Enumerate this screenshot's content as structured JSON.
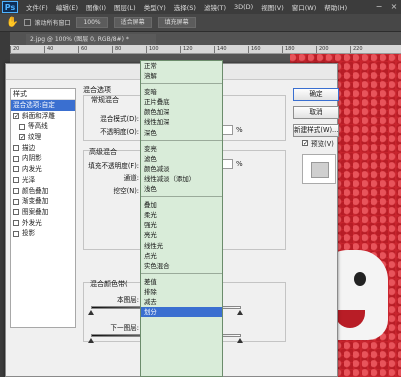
{
  "app": {
    "logo": "Ps",
    "menus": [
      "文件(F)",
      "编辑(E)",
      "图像(I)",
      "图层(L)",
      "类型(Y)",
      "选择(S)",
      "滤镜(T)",
      "3D(D)",
      "视图(V)",
      "窗口(W)",
      "帮助(H)"
    ]
  },
  "options_bar": {
    "scroll_all_label": "滚动所有窗口",
    "zoom_100": "100%",
    "fit_screen": "适合屏幕",
    "fill_screen": "填充屏幕"
  },
  "document": {
    "tab_title": "2.jpg @ 100% (图层 0, RGB/8#) *",
    "ruler_ticks": [
      "20",
      "40",
      "60",
      "80",
      "100",
      "120",
      "140",
      "160",
      "180",
      "200",
      "220"
    ]
  },
  "dialog": {
    "title": "图层样式",
    "styles_header": "样式",
    "styles": [
      {
        "label": "混合选项:自定",
        "checkbox": false,
        "checked": false,
        "indent": false,
        "selected": true
      },
      {
        "label": "斜面和浮雕",
        "checkbox": true,
        "checked": true,
        "indent": false,
        "selected": false
      },
      {
        "label": "等高线",
        "checkbox": true,
        "checked": false,
        "indent": true,
        "selected": false
      },
      {
        "label": "纹理",
        "checkbox": true,
        "checked": true,
        "indent": true,
        "selected": false
      },
      {
        "label": "描边",
        "checkbox": true,
        "checked": false,
        "indent": false,
        "selected": false
      },
      {
        "label": "内阴影",
        "checkbox": true,
        "checked": false,
        "indent": false,
        "selected": false
      },
      {
        "label": "内发光",
        "checkbox": true,
        "checked": false,
        "indent": false,
        "selected": false
      },
      {
        "label": "光泽",
        "checkbox": true,
        "checked": false,
        "indent": false,
        "selected": false
      },
      {
        "label": "颜色叠加",
        "checkbox": true,
        "checked": false,
        "indent": false,
        "selected": false
      },
      {
        "label": "渐变叠加",
        "checkbox": true,
        "checked": false,
        "indent": false,
        "selected": false
      },
      {
        "label": "图案叠加",
        "checkbox": true,
        "checked": false,
        "indent": false,
        "selected": false
      },
      {
        "label": "外发光",
        "checkbox": true,
        "checked": false,
        "indent": false,
        "selected": false
      },
      {
        "label": "投影",
        "checkbox": true,
        "checked": false,
        "indent": false,
        "selected": false
      }
    ],
    "blend_options_title": "混合选项",
    "general_blend_title": "常规混合",
    "blend_mode_label": "混合模式(D):",
    "blend_mode_value": "划分",
    "opacity_label": "不透明度(O):",
    "pct": "%",
    "advanced_blend_title": "高级混合",
    "fill_opacity_label": "填充不透明度(F):",
    "channels_label": "通道:",
    "knockout_label": "挖空(N):",
    "blend_if_label": "混合颜色带(",
    "this_layer_label": "本图层:",
    "underlying_label": "下一图层:",
    "buttons": {
      "ok": "确定",
      "cancel": "取消",
      "new_style": "新建样式(W)...",
      "preview": "预览(V)"
    },
    "preview_checked": true
  },
  "blend_mode_dropdown": {
    "groups": [
      [
        "正常",
        "溶解"
      ],
      [
        "变暗",
        "正片叠底",
        "颜色加深",
        "线性加深",
        "深色"
      ],
      [
        "变亮",
        "滤色",
        "颜色减淡",
        "线性减淡（添加）",
        "浅色"
      ],
      [
        "叠加",
        "柔光",
        "强光",
        "亮光",
        "线性光",
        "点光",
        "实色混合"
      ],
      [
        "差值",
        "排除",
        "减去",
        "划分"
      ]
    ],
    "selected": "划分"
  }
}
